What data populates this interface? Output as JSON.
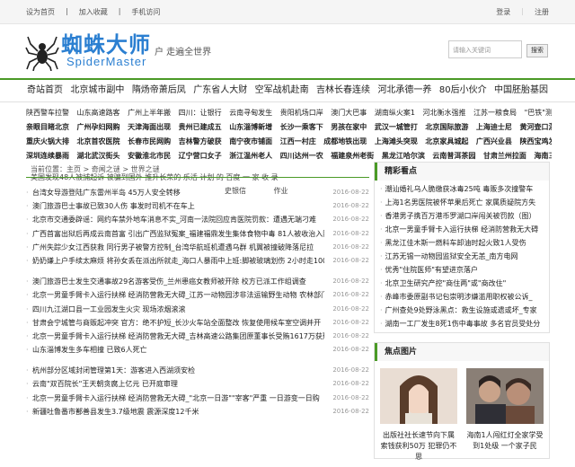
{
  "topbar": {
    "links": [
      "设为首页",
      "加入收藏",
      "手机访问"
    ],
    "login": "登录",
    "register": "注册"
  },
  "header": {
    "logo_cn": "蜘蛛大师",
    "logo_en": "SpiderMaster",
    "slogan": "户 走遍全世界",
    "search_placeholder": "请输入关键词",
    "search_button": "搜索"
  },
  "nav": {
    "items": [
      "奇站首页",
      "北京城市副中",
      "隋炀帝萧后凤",
      "广东省人大财",
      "空军战机赴南",
      "吉林长春连续",
      "河北承德一养",
      "80后小伙介",
      "中国胚胎基因"
    ]
  },
  "hotlinks": {
    "rows": [
      [
        "陕西警车拉警",
        "山东高速路客",
        "广州上半年搬",
        "四川：让银行",
        "云南寻甸发生",
        "贵阳机场口岸",
        "澳门大巴事",
        "湖南纵火案1",
        "河北衡水强推",
        "江苏一粮食局",
        "\"巴铁\"测试后"
      ],
      [
        "亲眼目睹北京",
        "广州孕妇网购",
        "天津海面出现",
        "贵州已建成五",
        "山东淄博新增",
        "长沙一乘客下",
        "男孩在家中",
        "武汉一城管打",
        "北京国际旅游",
        "上海迪士尼",
        "黄河壶口瀑布"
      ],
      [
        "重庆火锅大排",
        "北京首农医院",
        "长春市民网购",
        "吉林警方破获",
        "南宁夜市铺面",
        "江西一村庄",
        "成都地铁出现",
        "上海滩头突现",
        "北京家具城起",
        "广西兴业县",
        "陕西宝鸡发现"
      ],
      [
        "深圳连续暴雨",
        "湖北武汉街头",
        "安徽淮北市民",
        "辽宁营口女子",
        "浙江温州老人",
        "四川达州一农",
        "福建泉州老街",
        "黑龙江哈尔滨",
        "云南普洱茶园",
        "甘肃兰州拉面",
        "海南三亚渔民"
      ]
    ]
  },
  "breadcrumb": "当前位置：主页 > 奇闻之谜 > 世界之谜",
  "overlay": {
    "row1": "美国发现48人被捕起诉 被骗到国外 推升长荣的 乐活 计划 的 百度 一 家 收 录",
    "row2": [
      "史银信",
      "作业"
    ]
  },
  "news": [
    {
      "title": "台湾女导游登陆广东雷州半岛 45万人安全转移",
      "date": "2016-08-22"
    },
    {
      "title": "澳门旅游巴士事故已致30人伤 事发时司机不在车上",
      "date": "2016-08-22"
    },
    {
      "title": "北京市交通委辟谣：网约车禁外地车消息不实_河南一法院回应肯医院罚款：遭遇无端刁难",
      "date": "2016-08-22"
    },
    {
      "title": "广西首富出狱后再成云南首富 引出广西监狱冤案_福建福鼎发生集体食物中毒 81人被收治入院",
      "date": "2016-08-22"
    },
    {
      "title": "广州失踪少女江西获救 同行男子被警方控制_台湾华航班机遭遇乌群 机翼被撞破降落尼拉",
      "date": "2016-08-22"
    },
    {
      "title": "奶奶嫌上户手续太麻烦 将孙女丢在派出所就走_海口人暴雨中上班:脚被玻璃划伤 2小时走100",
      "date": "2016-08-22"
    },
    {
      "title": "澳门旅游巴士发生交通事故29名游客受伤_兰州患癌女教师被开除 校方已派工作组调查",
      "date": "2016-08-22",
      "gap": true
    },
    {
      "title": "北京一男童手臂卡入运行扶梯 经消防营救无大碍_江苏一动物园涉非法运输野生动物 农林部门",
      "date": "2016-08-22"
    },
    {
      "title": "四川九江湖口县一工业园发生火灾 现场浓烟滚滚",
      "date": "2016-08-22"
    },
    {
      "title": "甘肃会宁城管与商贩起冲突 官方：绝不护短_长沙火车站全面整改 恢复使用候车室空调并开",
      "date": "2016-08-22"
    },
    {
      "title": "北京一男童手臂卡入运行扶梯 经消防营救无大碍_吉林高速公路集团原董事长受贿1617万获刑",
      "date": "2016-08-22"
    },
    {
      "title": "山东淄博发生多车相撞 已致6人死亡",
      "date": "2016-08-22"
    },
    {
      "title": "杭州部分区域封闭管理第1天：游客进入西湖须安检",
      "date": "2016-08-22",
      "gap": true
    },
    {
      "title": "云南\"双百院长\"王天朝贪腐上亿元 已开庭审理",
      "date": "2016-08-22"
    },
    {
      "title": "北京一男童手臂卡入运行扶梯 经消防营救无大碍_\"北京一日游\"\"宰客\"严重 一日游变一日购",
      "date": "2016-08-22"
    },
    {
      "title": "新疆吐鲁番市鄯善县发生3.7级地震 震源深度12千米",
      "date": "2016-08-22"
    }
  ],
  "sidebar": {
    "hot_title": "精彩看点",
    "hot_items": [
      "潮汕婚礼乌人脆缴获冰毒25吨 毒贩多次撞警车",
      "上海1名男医院被怀苹果后死亡 家属质疑院方失",
      "香港男子携百万港币罗湖口岸闯关被罚款（图）",
      "北京一男童手臂卡入运行扶梯 经消防营救无大碍",
      "黑龙江佳木斯一燃料车卸油时起火致1人受伤",
      "江苏无锡一动物园监狱安全无恙_南方电网",
      "优秀\"住院医师\"有望进京落户",
      "北京卫生研究产控\"商住两\"或\"商改住\"",
      "赤峰市委原副书记包崇明涉嫌滥用职权被公诉_",
      "广州查处9处野泳黑点：救生设施或遗或坏_专家",
      "湖南一工厂发生8死1伤中毒事故 多名官员受处分"
    ],
    "pic_title": "焦点图片",
    "pics": [
      {
        "caption": "出版社社长速节向下属索钱获利50万 犯罪仍不思"
      },
      {
        "caption": "海南1人闯红灯全家学受到1处级 一个家子民"
      }
    ]
  }
}
